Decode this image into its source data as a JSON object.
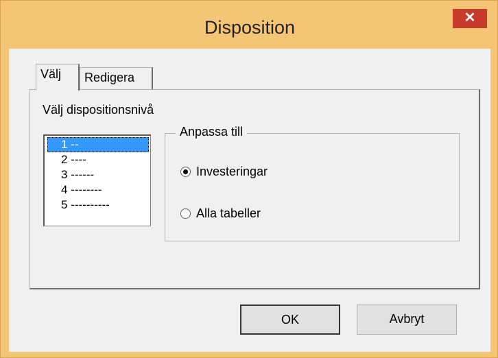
{
  "window": {
    "title": "Disposition",
    "close_glyph": "✕"
  },
  "tabs": [
    {
      "label": "Välj",
      "active": true
    },
    {
      "label": "Redigera",
      "active": false
    }
  ],
  "valj": {
    "section_label": "Välj dispositionsnivå",
    "levels": [
      {
        "label": "1 --",
        "selected": true
      },
      {
        "label": "2 ----",
        "selected": false
      },
      {
        "label": "3 ------",
        "selected": false
      },
      {
        "label": "4 --------",
        "selected": false
      },
      {
        "label": "5 ----------",
        "selected": false
      }
    ],
    "group": {
      "title": "Anpassa till",
      "options": [
        {
          "label": "Investeringar",
          "checked": true
        },
        {
          "label": "Alla tabeller",
          "checked": false
        }
      ]
    }
  },
  "buttons": {
    "ok": "OK",
    "cancel": "Avbryt"
  },
  "colors": {
    "titlebar": "#f5c576",
    "close": "#c83b2a",
    "selection": "#3399ff",
    "dialog": "#f0f0f0"
  }
}
